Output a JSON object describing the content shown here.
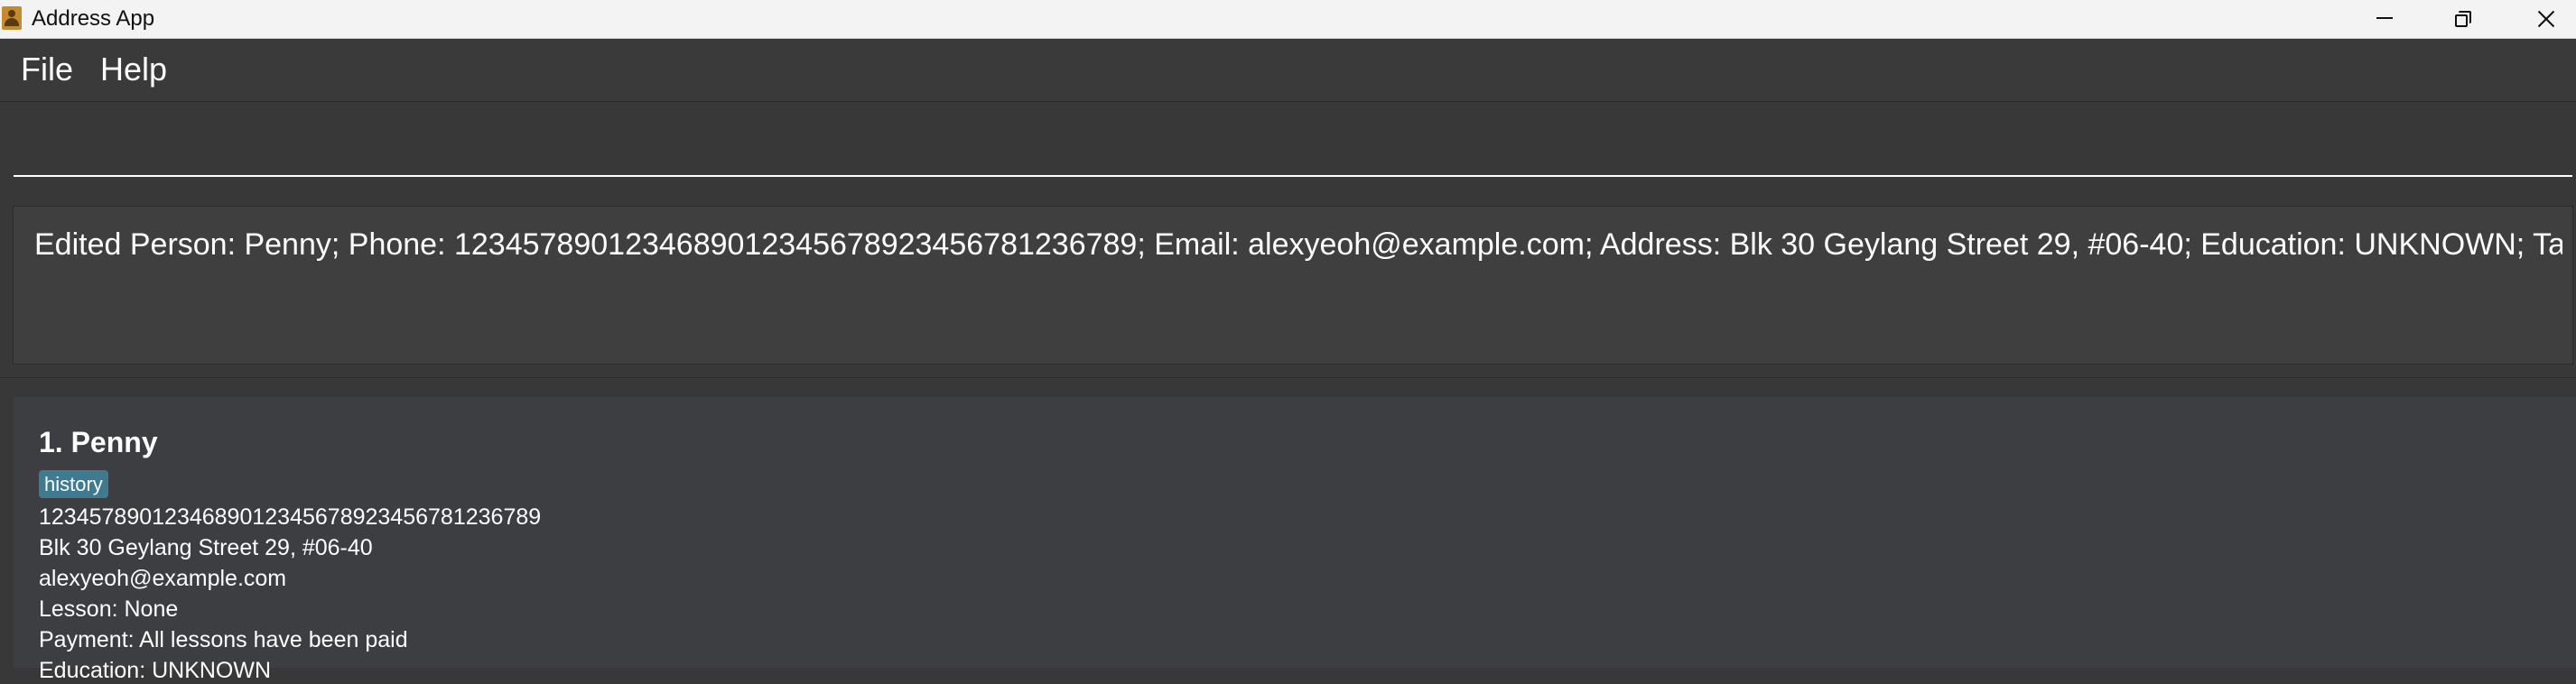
{
  "window": {
    "title": "Address App",
    "icon": "address-book-icon",
    "controls": [
      "minimize-icon",
      "maximize-icon",
      "close-icon"
    ]
  },
  "menu": {
    "file_label": "File",
    "help_label": "Help"
  },
  "command_box": {
    "value": "",
    "placeholder": ""
  },
  "result_display": {
    "text": "Edited Person: Penny; Phone: 1234578901234689012345678923456781236789; Email: alexyeoh@example.com; Address: Blk 30 Geylang Street 29, #06-40; Education: UNKNOWN; Tags: [history]"
  },
  "person_list": {
    "persons": [
      {
        "header": "1. Penny",
        "tags": [
          "history"
        ],
        "phone": "1234578901234689012345678923456781236789",
        "address": "Blk 30 Geylang Street 29, #06-40",
        "email": "alexyeoh@example.com",
        "lesson": "Lesson: None",
        "payment": "Payment: All lessons have been paid",
        "education": "Education: UNKNOWN"
      }
    ]
  },
  "colors": {
    "background": "#383838",
    "card": "#3c3e41",
    "tag": "#3e7b91",
    "titlebar": "#f3f3f3",
    "text": "#ffffff"
  }
}
